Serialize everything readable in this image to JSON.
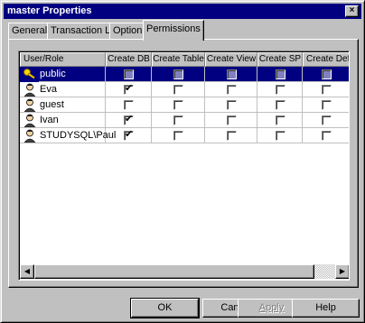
{
  "window": {
    "title": "master Properties",
    "close_glyph": "×"
  },
  "tabs": [
    {
      "label": "General",
      "active": false
    },
    {
      "label": "Transaction Log",
      "active": false
    },
    {
      "label": "Options",
      "active": false
    },
    {
      "label": "Permissions",
      "active": true
    }
  ],
  "grid": {
    "columns": [
      "User/Role",
      "Create DB",
      "Create Table",
      "Create View",
      "Create SP",
      "Create Defa"
    ],
    "rows": [
      {
        "name": "public",
        "icon": "role-key-icon",
        "selected": true,
        "perms": [
          false,
          false,
          false,
          false,
          false
        ]
      },
      {
        "name": "Eva",
        "icon": "user-icon",
        "selected": false,
        "perms": [
          true,
          false,
          false,
          false,
          false
        ]
      },
      {
        "name": "guest",
        "icon": "user-icon",
        "selected": false,
        "perms": [
          false,
          false,
          false,
          false,
          false
        ]
      },
      {
        "name": "Ivan",
        "icon": "user-icon",
        "selected": false,
        "perms": [
          true,
          false,
          false,
          false,
          false
        ]
      },
      {
        "name": "STUDYSQL\\Paul",
        "icon": "user-icon",
        "selected": false,
        "perms": [
          true,
          false,
          false,
          false,
          false
        ]
      }
    ],
    "check_glyph": "✔"
  },
  "scrollbar": {
    "left_glyph": "◀",
    "right_glyph": "▶"
  },
  "buttons": {
    "ok": "OK",
    "cancel": "Cancel",
    "apply": "Apply",
    "help": "Help"
  },
  "colors": {
    "selection": "#000080",
    "face": "#c0c0c0"
  }
}
